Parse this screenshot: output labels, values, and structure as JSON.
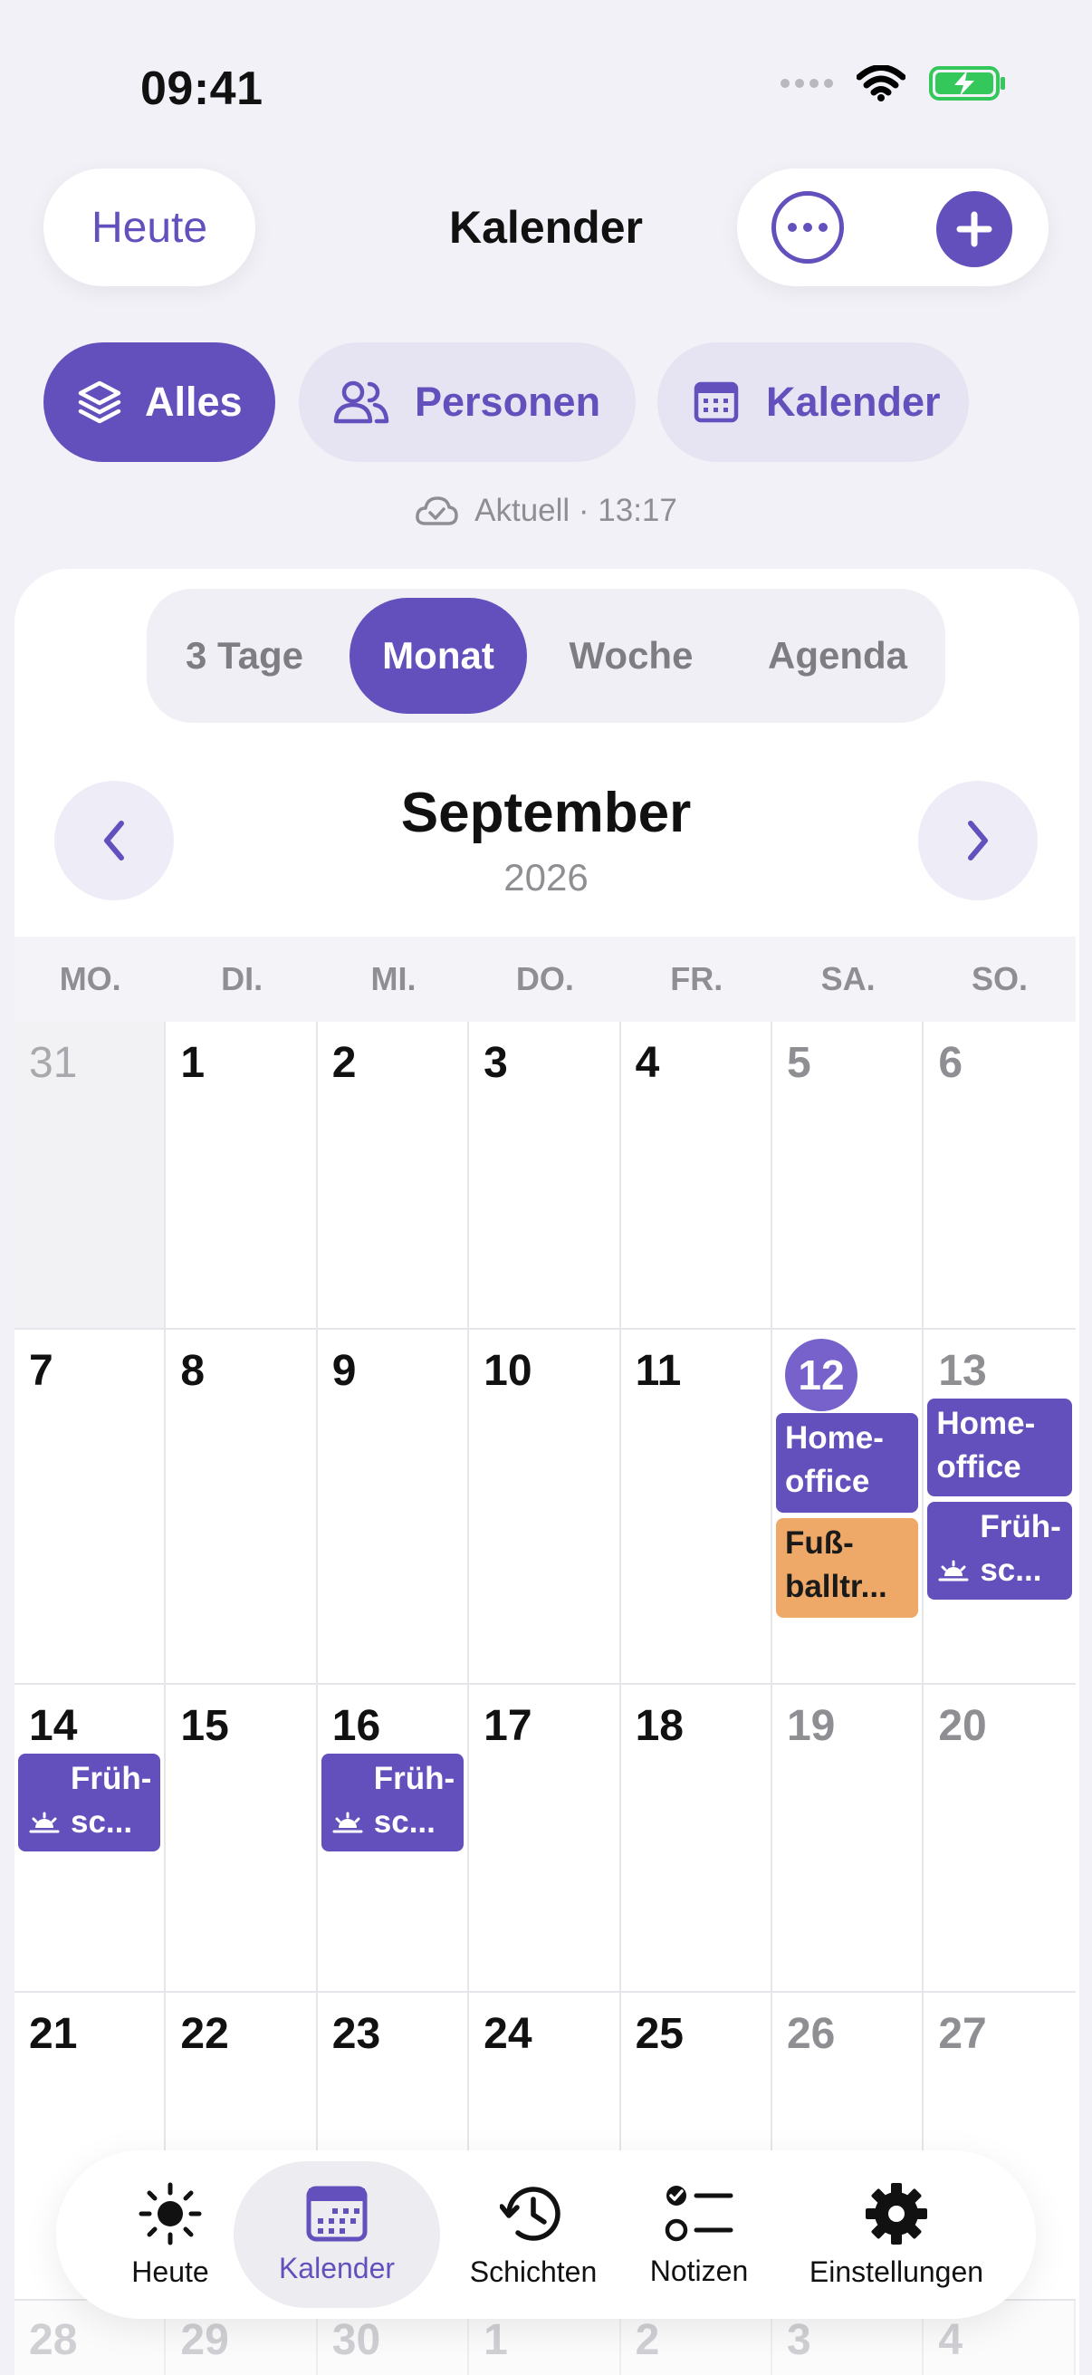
{
  "status_bar": {
    "time": "09:41"
  },
  "header": {
    "today_button": "Heute",
    "title": "Kalender",
    "more_icon": "ellipsis-circle-icon",
    "add_icon": "plus-circle-icon"
  },
  "filters": [
    {
      "label": "Alles",
      "icon": "layers-icon",
      "active": true
    },
    {
      "label": "Personen",
      "icon": "people-icon",
      "active": false
    },
    {
      "label": "Kalender",
      "icon": "calendar-icon",
      "active": false
    }
  ],
  "sync_status": "Aktuell · 13:17",
  "view_modes": [
    {
      "label": "3 Tage",
      "active": false
    },
    {
      "label": "Monat",
      "active": true
    },
    {
      "label": "Woche",
      "active": false
    },
    {
      "label": "Agenda",
      "active": false
    }
  ],
  "month": {
    "name": "September",
    "year": "2026"
  },
  "weekdays": [
    "MO.",
    "DI.",
    "MI.",
    "DO.",
    "FR.",
    "SA.",
    "SO."
  ],
  "weeks": [
    [
      "31",
      "1",
      "2",
      "3",
      "4",
      "5",
      "6"
    ],
    [
      "7",
      "8",
      "9",
      "10",
      "11",
      "12",
      "13"
    ],
    [
      "14",
      "15",
      "16",
      "17",
      "18",
      "19",
      "20"
    ],
    [
      "21",
      "22",
      "23",
      "24",
      "25",
      "26",
      "27"
    ]
  ],
  "partial_week": [
    "28",
    "29",
    "30",
    "1",
    "2",
    "3",
    "4"
  ],
  "events": {
    "homeoffice": "Home-\noffice",
    "fussball": "Fuß-\nballtr...",
    "fruehschicht": "Früh-\nsc..."
  },
  "colors": {
    "accent": "#6350bd",
    "event_orange": "#eea868"
  },
  "tabs": [
    {
      "label": "Heute",
      "icon": "sun-icon",
      "active": false
    },
    {
      "label": "Kalender",
      "icon": "calendar-icon",
      "active": true
    },
    {
      "label": "Schichten",
      "icon": "clock-history-icon",
      "active": false
    },
    {
      "label": "Notizen",
      "icon": "checklist-icon",
      "active": false
    },
    {
      "label": "Einstellungen",
      "icon": "gear-icon",
      "active": false
    }
  ]
}
